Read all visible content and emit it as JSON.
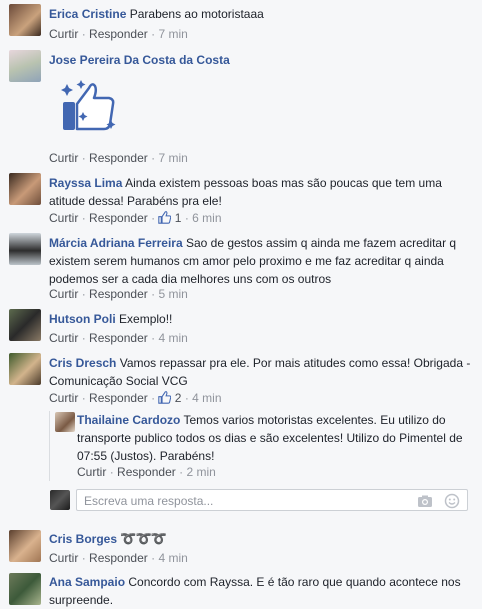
{
  "actions": {
    "reply": "Responder",
    "like": "Curtir",
    "sep": "·"
  },
  "comments": [
    {
      "name": "Erica Cristine",
      "text": "Parabens ao motoristaaa",
      "time": "7 min"
    },
    {
      "name": "Jose Pereira Da Costa da Costa",
      "text": "",
      "time": "7 min"
    },
    {
      "name": "Rayssa Lima",
      "text": "Ainda existem pessoas boas mas são poucas que tem uma atitude dessa! Parabéns pra ele!",
      "likes": "1",
      "time": "6 min"
    },
    {
      "name": "Márcia Adriana Ferreira",
      "text": "Sao de gestos assim q ainda me fazem acreditar q existem serem humanos cm amor pelo proximo e me faz acreditar q ainda podemos ser a cada dia melhores uns com os outros",
      "time": "5 min"
    },
    {
      "name": "Hutson Poli",
      "text": "Exemplo!!",
      "time": "4 min"
    },
    {
      "name": "Cris Dresch",
      "text": "Vamos repassar pra ele. Por mais atitudes como essa! Obrigada - Comunicação Social VCG",
      "likes": "2",
      "time": "4 min"
    },
    {
      "name": "Cris Borges",
      "text": "",
      "time": "4 min"
    },
    {
      "name": "Ana Sampaio",
      "text": "Concordo com Rayssa. E é tão raro que quando acontece nos surpreende.",
      "time": ""
    }
  ],
  "reply": {
    "name": "Thailaine Cardozo",
    "text": "Temos varios motoristas excelentes. Eu utilizo do transporte publico todos os dias e são excelentes! Utilizo do Pimentel de 07:55 (Justos). Parabéns!",
    "time": "2 min"
  },
  "reply_box": {
    "placeholder": "Escreva uma resposta..."
  },
  "icons": [
    "thumbs-up-sticker-icon",
    "like-count-icon",
    "camera-icon",
    "emoji-icon"
  ],
  "colors": {
    "name": "#365899",
    "meta": "#90949c",
    "link": "#4b4f56",
    "background": "#f6f7f9",
    "like_blue": "#4267b2"
  }
}
